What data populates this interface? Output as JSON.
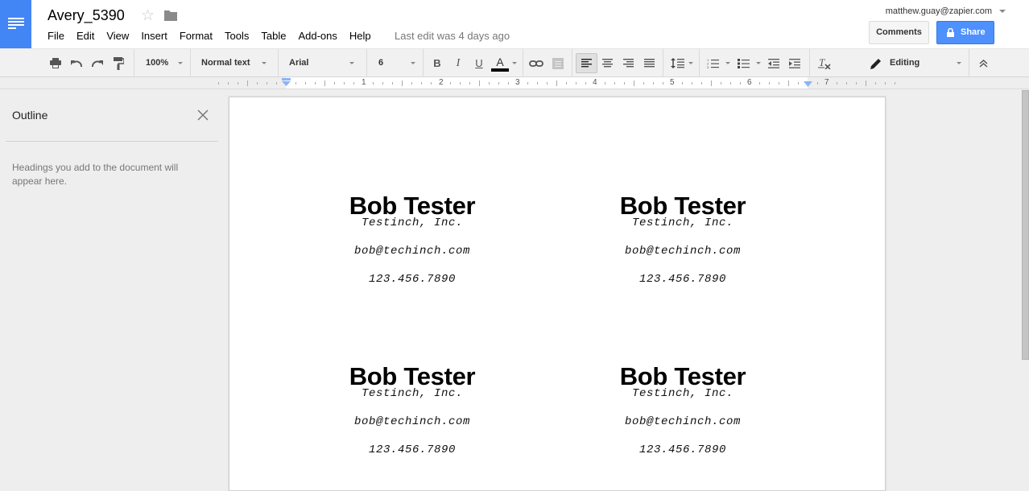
{
  "app": {
    "name": "Google Docs"
  },
  "document": {
    "title": "Avery_5390",
    "last_edit": "Last edit was 4 days ago"
  },
  "menu": {
    "items": [
      "File",
      "Edit",
      "View",
      "Insert",
      "Format",
      "Tools",
      "Table",
      "Add-ons",
      "Help"
    ]
  },
  "account": {
    "email": "matthew.guay@zapier.com"
  },
  "buttons": {
    "comments": "Comments",
    "share": "Share"
  },
  "colors": {
    "brand_blue": "#4285f4",
    "share_blue": "#4d90fe",
    "ruler_marker": "#8ab4f8",
    "text_color_bar": "#000000"
  },
  "toolbar": {
    "zoom": "100%",
    "style": "Normal text",
    "font": "Arial",
    "font_size": "6",
    "mode": "Editing",
    "alignment_active": "left",
    "icons": [
      "print-icon",
      "undo-icon",
      "redo-icon",
      "paint-format-icon",
      "bold-icon",
      "italic-icon",
      "underline-icon",
      "text-color-icon",
      "link-icon",
      "comment-icon",
      "align-left-icon",
      "align-center-icon",
      "align-right-icon",
      "align-justify-icon",
      "line-spacing-icon",
      "numbered-list-icon",
      "bulleted-list-icon",
      "decrease-indent-icon",
      "increase-indent-icon",
      "clear-formatting-icon",
      "pencil-icon",
      "collapse-icon"
    ],
    "labels": {
      "bold": "B",
      "italic": "I",
      "underline": "U",
      "text_color": "A"
    }
  },
  "ruler": {
    "numbers": [
      "1",
      "2",
      "3",
      "4",
      "5",
      "6",
      "7"
    ]
  },
  "outline": {
    "title": "Outline",
    "hint": "Headings you add to the document will appear here."
  },
  "labels": [
    {
      "name": "Bob Tester",
      "company": "Testinch, Inc.",
      "email": "bob@techinch.com",
      "phone": "123.456.7890"
    },
    {
      "name": "Bob Tester",
      "company": "Testinch, Inc.",
      "email": "bob@techinch.com",
      "phone": "123.456.7890"
    },
    {
      "name": "Bob Tester",
      "company": "Testinch, Inc.",
      "email": "bob@techinch.com",
      "phone": "123.456.7890"
    },
    {
      "name": "Bob Tester",
      "company": "Testinch, Inc.",
      "email": "bob@techinch.com",
      "phone": "123.456.7890"
    }
  ]
}
